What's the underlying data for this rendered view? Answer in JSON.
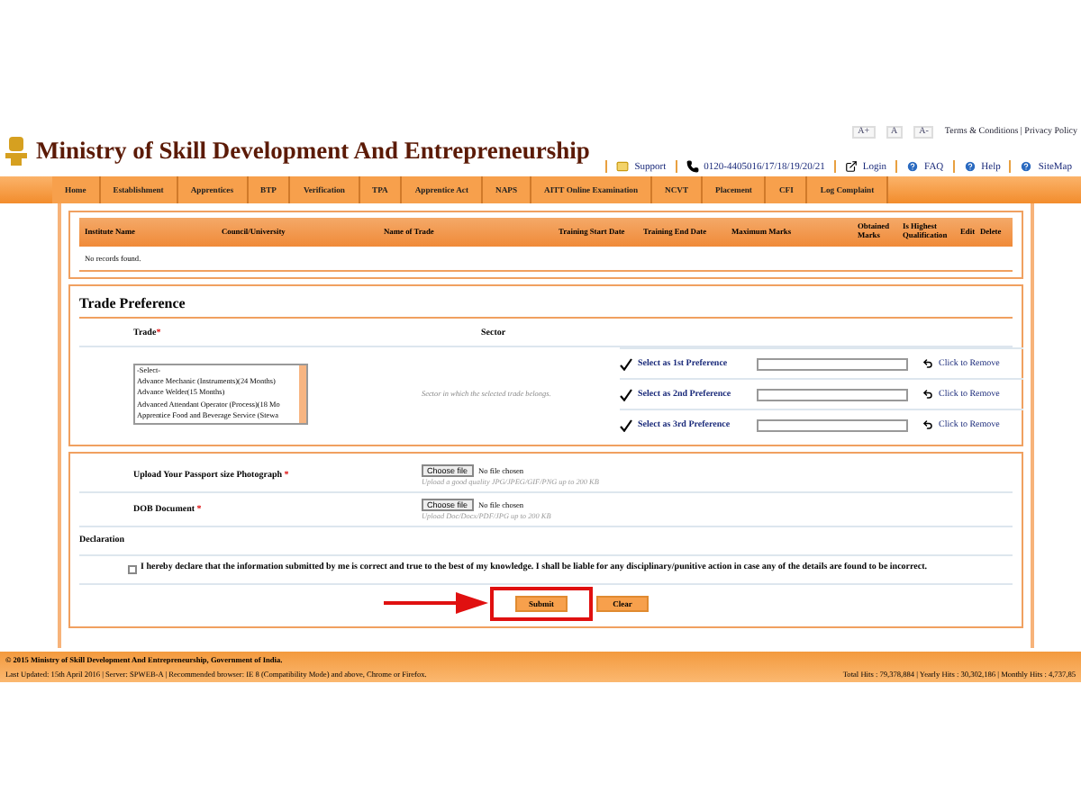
{
  "header": {
    "title": "Ministry of Skill Development And Entrepreneurship",
    "font_sizes": [
      "A+",
      "A",
      "A-"
    ],
    "top_links": "Terms & Conditions | Privacy Policy",
    "links": [
      {
        "kind": "mail",
        "label": "Support"
      },
      {
        "kind": "phone",
        "label": "0120-4405016/17/18/19/20/21"
      },
      {
        "kind": "login",
        "label": "Login"
      },
      {
        "kind": "help",
        "label": "FAQ"
      },
      {
        "kind": "help",
        "label": "Help"
      },
      {
        "kind": "help",
        "label": "SiteMap"
      }
    ]
  },
  "nav": [
    "Home",
    "Establishment",
    "Apprentices",
    "BTP",
    "Verification",
    "TPA",
    "Apprentice Act",
    "NAPS",
    "AITT Online Examination",
    "NCVT",
    "Placement",
    "CFI",
    "Log Complaint"
  ],
  "qualification_table": {
    "columns": [
      "Institute Name",
      "Council/University",
      "Name of Trade",
      "Training Start Date",
      "Training End Date",
      "Maximum Marks",
      "Obtained Marks",
      "Is Highest Qualification",
      "Edit",
      "Delete"
    ],
    "empty_message": "No records found."
  },
  "trade_preference": {
    "title": "Trade Preference",
    "trade_label": "Trade",
    "required_mark": "*",
    "sector_label": "Sector",
    "trade_options": [
      "-Select-",
      "Advance Mechanic (Instruments)(24 Months)",
      "Advance Welder(15 Months)",
      "Advanced Attendant Operator (Process)(18 Mo",
      "Apprentice Food and Beverage Service (Stewa"
    ],
    "sector_hint": "Sector in which the selected trade belongs.",
    "preferences": [
      {
        "label": "Select as 1st Preference",
        "remove": "Click to Remove"
      },
      {
        "label": "Select as 2nd Preference",
        "remove": "Click to Remove"
      },
      {
        "label": "Select as 3rd Preference",
        "remove": "Click to Remove"
      }
    ]
  },
  "uploads": [
    {
      "label": "Upload Your Passport size Photograph",
      "required_mark": "*",
      "button": "Choose file",
      "status": "No file chosen",
      "hint": "Upload a good quality JPG/JPEG/GIF/PNG up to 200 KB"
    },
    {
      "label": "DOB Document",
      "required_mark": "*",
      "button": "Choose file",
      "status": "No file chosen",
      "hint": "Upload Doc/Docx/PDF/JPG up to 200 KB"
    }
  ],
  "declaration": {
    "title": "Declaration",
    "checked": false,
    "text": "I hereby declare that the information submitted by me is correct and true to the best of my knowledge. I shall be liable for any disciplinary/punitive action in case any of the details are found to be incorrect."
  },
  "buttons": [
    {
      "label": "Submit",
      "highlighted": true
    },
    {
      "label": "Clear",
      "highlighted": false
    }
  ],
  "footer": {
    "copyright": "© 2015 Ministry of Skill Development And Entrepreneurship, Government of India.",
    "updated": "Last Updated: 15th April 2016 | Server: SPWEB-A | Recommended browser: IE 8 (Compatibility Mode) and above, Chrome or Firefox.",
    "hits": "Total Hits : 79,378,884 | Yearly Hits : 30,302,186 | Monthly Hits : 4,737,85"
  }
}
